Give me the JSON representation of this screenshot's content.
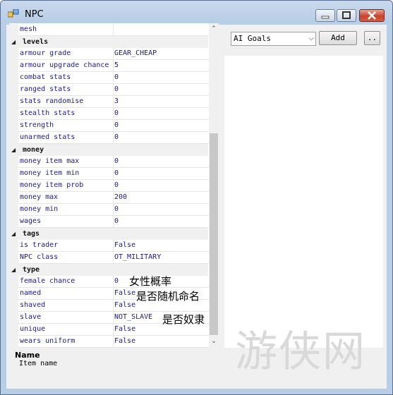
{
  "window": {
    "title": "NPC",
    "accent": "#b8cde6"
  },
  "grid": {
    "rows": [
      {
        "kind": "prop",
        "name": "mesh",
        "value": ""
      },
      {
        "kind": "cat",
        "name": "levels"
      },
      {
        "kind": "prop",
        "name": "armour grade",
        "value": "GEAR_CHEAP"
      },
      {
        "kind": "prop",
        "name": "armour upgrade chance",
        "value": "5"
      },
      {
        "kind": "prop",
        "name": "combat stats",
        "value": "0"
      },
      {
        "kind": "prop",
        "name": "ranged stats",
        "value": "0"
      },
      {
        "kind": "prop",
        "name": "stats randomise",
        "value": "3"
      },
      {
        "kind": "prop",
        "name": "stealth stats",
        "value": "0"
      },
      {
        "kind": "prop",
        "name": "strength",
        "value": "0"
      },
      {
        "kind": "prop",
        "name": "unarmed stats",
        "value": "0"
      },
      {
        "kind": "cat",
        "name": "money"
      },
      {
        "kind": "prop",
        "name": "money item max",
        "value": "0"
      },
      {
        "kind": "prop",
        "name": "money item min",
        "value": "0"
      },
      {
        "kind": "prop",
        "name": "money item prob",
        "value": "0"
      },
      {
        "kind": "prop",
        "name": "money max",
        "value": "200"
      },
      {
        "kind": "prop",
        "name": "money min",
        "value": "0"
      },
      {
        "kind": "prop",
        "name": "wages",
        "value": "0"
      },
      {
        "kind": "cat",
        "name": "tags"
      },
      {
        "kind": "prop",
        "name": "is trader",
        "value": "False"
      },
      {
        "kind": "prop",
        "name": "NPC class",
        "value": "OT_MILITARY"
      },
      {
        "kind": "cat",
        "name": "type"
      },
      {
        "kind": "prop",
        "name": "female chance",
        "value": "0"
      },
      {
        "kind": "prop",
        "name": "named",
        "value": "False"
      },
      {
        "kind": "prop",
        "name": "shaved",
        "value": "False"
      },
      {
        "kind": "prop",
        "name": "slave",
        "value": "NOT_SLAVE"
      },
      {
        "kind": "prop",
        "name": "unique",
        "value": "False"
      },
      {
        "kind": "prop",
        "name": "wears uniform",
        "value": "False"
      }
    ],
    "scroll_up_glyph": "⌃",
    "scroll_down_glyph": "⌄",
    "expand_glyph": "◢"
  },
  "annotations": {
    "female_chance": "女性概率",
    "named": "是否随机命名",
    "slave": "是否奴隶"
  },
  "description": {
    "title": "Name",
    "text": "Item name"
  },
  "goals": {
    "combo_value": "AI Goals",
    "add_label": "Add",
    "more_label": ".."
  },
  "watermark": "游侠网"
}
